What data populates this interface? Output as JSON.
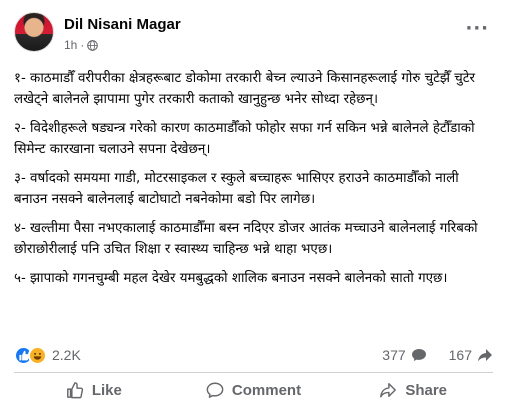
{
  "post": {
    "author": "Dil Nisani Magar",
    "time": "1h",
    "dot": "·",
    "more": "···",
    "paragraphs": [
      "१- काठमाडौँ वरीपरीका क्षेत्रहरूबाट डोकोमा तरकारी बेच्न ल्याउने किसानहरूलाई गोरु चुटेझैँ चुटेर लखेट्ने बालेनले झापामा पुगेर तरकारी कताको खानुहुन्छ भनेर सोध्दा रहेछन्।",
      "२- विदेशीहरूले षड्यन्त्र गरेको कारण काठमाडौँको फोहोर सफा गर्न सकिन भन्ने बालेनले हेटौँडाको सिमेन्ट कारखाना चलाउने सपना देखेछन्।",
      "३- वर्षादको समयमा गाडी, मोटरसाइकल र स्कुले बच्चाहरू भासिएर हराउने काठमाडौँको नाली बनाउन नसक्ने बालेनलाई बाटोघाटो नबनेकोमा बडो पिर लागेछ।",
      "४- खल्तीमा पैसा नभएकालाई काठमाडौँमा बस्न नदिएर डोजर आतंक मच्चाउने बालेनलाई गरिबको छोराछोरीलाई पनि उचित शिक्षा र स्वास्थ्य चाहिन्छ भन्ने थाहा भएछ।",
      "५-  झापाको  गगनचुम्बी महल देखेर यमबुद्धको शालिक बनाउन नसक्ने बालेनको सातो गएछ।"
    ]
  },
  "stats": {
    "reactions_count": "2.2K",
    "comments_count": "377",
    "shares_count": "167"
  },
  "actions": {
    "like": "Like",
    "comment": "Comment",
    "share": "Share"
  },
  "colors": {
    "text": "#050505",
    "muted": "#65676b",
    "like_blue": "#1877f2",
    "haha_yellow": "#f7b125",
    "divider": "#ced0d4"
  }
}
